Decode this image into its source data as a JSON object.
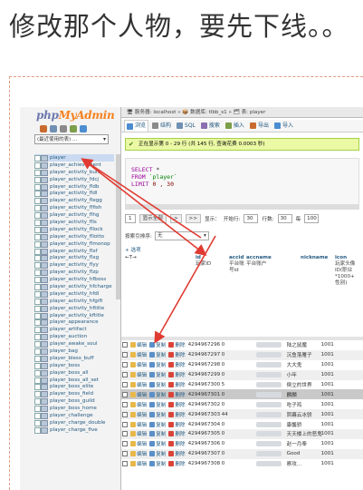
{
  "headline": "修改那个人物，要先下线。。",
  "colors": {
    "arrow": "#e03b32",
    "frame": "#e59c80",
    "logo_php": "#6c78af",
    "logo_myadmin": "#f58220",
    "link": "#235a81"
  },
  "pma": {
    "logo_php": "php",
    "logo_myadmin": "MyAdmin",
    "db_select": "(最近使用的表) ...",
    "tables": [
      "player",
      "player_achievement",
      "player_activity_bufs",
      "player_activity_fdcj",
      "player_activity_fldb",
      "player_activity_fldl",
      "player_activity_flegg",
      "player_activity_flfish",
      "player_activity_flhg",
      "player_activity_flls",
      "player_activity_fllock",
      "player_activity_fllotto",
      "player_activity_flmonop",
      "player_activity_flxf",
      "player_activity_flxg",
      "player_activity_flyy",
      "player_activity_flzp",
      "player_activity_hfboss",
      "player_activity_hfcharge",
      "player_activity_hfdl",
      "player_activity_hfgift",
      "player_activity_hftitle",
      "player_activity_kftitle",
      "player_appearance",
      "player_artifact",
      "player_auction",
      "player_awake_soul",
      "player_bag",
      "player_bless_buff",
      "player_boss",
      "player_boss_all",
      "player_boss_all_set",
      "player_boss_elite",
      "player_boss_field",
      "player_boss_guild",
      "player_boss_home",
      "player_challenge",
      "player_charge_double",
      "player_charge_five"
    ],
    "breadcrumb": "🖥 服务器: localhost » 📦 数据库: tlbb_s1 » 🗂 表: player",
    "tabs": [
      "浏览",
      "结构",
      "SQL",
      "搜索",
      "插入",
      "导出",
      "导入"
    ],
    "success": "正在显示第 0 - 29 行 (共 145 行, 查询花费 0.0003 秒)",
    "sql": {
      "select": "SELECT",
      "star": "*",
      "from": "FROM",
      "table": "`player`",
      "limit": "LIMIT",
      "limit_val": "0 , 30"
    },
    "pager": {
      "page": "1",
      "show_all": "显示全部",
      "next": ">",
      "last": ">>",
      "show_label": "显示：",
      "start_label": "开始行:",
      "start_val": "30",
      "rows_label": "行数:",
      "rows_val": "30",
      "header_label": "每",
      "header_val": "100"
    },
    "sort": {
      "label": "按索引排序:",
      "value": "无"
    },
    "options": "+ 选项",
    "nav_arrows": "←T→",
    "columns": {
      "id": "id",
      "id_sub": "玩家ID",
      "accid": "accid",
      "accid_sub1": "平台账",
      "accid_sub2": "号id",
      "accname": "accname",
      "accname_sub": "平台账户",
      "nickname": "nickname",
      "icon": "icon",
      "icon_sub1": "玩家头像",
      "icon_sub2": "ID(职业",
      "icon_sub3": "*1000+",
      "icon_sub4": "性别)"
    },
    "row_actions": {
      "edit": "编辑",
      "copy": "复制",
      "delete": "删除"
    },
    "rows": [
      {
        "id": "4294967296",
        "accid": "0",
        "nick": "陆之鼠魔",
        "icon": "1001"
      },
      {
        "id": "4294967297",
        "accid": "0",
        "nick": "沉鱼落雁子",
        "icon": "1001"
      },
      {
        "id": "4294967298",
        "accid": "0",
        "nick": "大大鬼",
        "icon": "1001"
      },
      {
        "id": "4294967299",
        "accid": "0",
        "nick": "小年",
        "icon": "1001"
      },
      {
        "id": "4294967300",
        "accid": "5",
        "nick": "倒立的世界",
        "icon": "1001"
      },
      {
        "id": "4294967301",
        "accid": "0",
        "nick": "麟麟",
        "icon": "1001"
      },
      {
        "id": "4294967302",
        "accid": "0",
        "nick": "吃子鸡",
        "icon": "1001"
      },
      {
        "id": "4294967303",
        "accid": "44",
        "nick": "阴暮云冰骄",
        "icon": "1001"
      },
      {
        "id": "4294967304",
        "accid": "0",
        "nick": "康馨骄",
        "icon": "1001"
      },
      {
        "id": "4294967305",
        "accid": "0",
        "nick": "天天楼上的恶鬼",
        "icon": "1001"
      },
      {
        "id": "4294967306",
        "accid": "0",
        "nick": "赵一月奉",
        "icon": "1001"
      },
      {
        "id": "4294967307",
        "accid": "0",
        "nick": "Good",
        "icon": "1001"
      },
      {
        "id": "4294967308",
        "accid": "0",
        "nick": "察攻...",
        "icon": "1001"
      }
    ]
  }
}
